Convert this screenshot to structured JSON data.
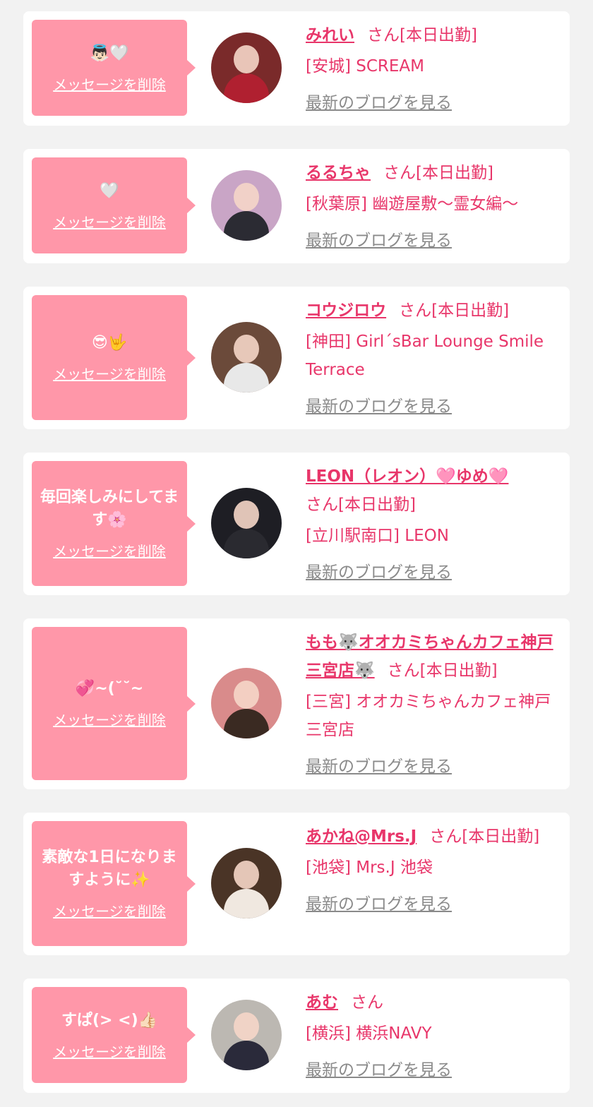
{
  "favorites": [
    {
      "message": "👼🏻🤍",
      "delete_label": "メッセージを削除",
      "name": "みれい",
      "suffix": "さん[本日出勤]",
      "shop": "[安城] SCREAM",
      "blog_label": "最新のブログを見る",
      "avatar_bg": "#7a2a2a",
      "avatar_body": "#b02030"
    },
    {
      "message": "🤍",
      "delete_label": "メッセージを削除",
      "name": "るるちゃ",
      "suffix": "さん[本日出勤]",
      "shop": "[秋葉原] 幽遊屋敷〜霊女編〜",
      "blog_label": "最新のブログを見る",
      "avatar_bg": "#c9a5c6",
      "avatar_body": "#2b2b33"
    },
    {
      "message": "😎🤟",
      "delete_label": "メッセージを削除",
      "name": "コウジロウ",
      "suffix": "さん[本日出勤]",
      "shop": "[神田] Girl´sBar Lounge Smile Terrace",
      "blog_label": "最新のブログを見る",
      "avatar_bg": "#6b4a3a",
      "avatar_body": "#e8e8e8"
    },
    {
      "message": "毎回楽しみにしてます🌸",
      "delete_label": "メッセージを削除",
      "name": "LEON（レオン）🩷ゆめ🩷",
      "suffix": "さん[本日出勤]",
      "shop": "[立川駅南口] LEON",
      "blog_label": "最新のブログを見る",
      "avatar_bg": "#1e1e24",
      "avatar_body": "#2a2a30"
    },
    {
      "message": "💞~(˘˘~",
      "delete_label": "メッセージを削除",
      "name": "もも🐺オオカミちゃんカフェ神戸三宮店🐺",
      "suffix": "さん[本日出勤]",
      "shop": "[三宮] オオカミちゃんカフェ神戸三宮店",
      "blog_label": "最新のブログを見る",
      "avatar_bg": "#d98b8b",
      "avatar_body": "#3a2a22"
    },
    {
      "message": "素敵な1日になりますように✨",
      "delete_label": "メッセージを削除",
      "name": "あかね@Mrs.J",
      "suffix": "さん[本日出勤]",
      "shop": "[池袋] Mrs.J 池袋",
      "blog_label": "最新のブログを見る",
      "avatar_bg": "#4a3426",
      "avatar_body": "#f0e8e0"
    },
    {
      "message": "すぱ(> <)👍🏻",
      "delete_label": "メッセージを削除",
      "name": "あむ",
      "suffix": "さん",
      "shop": "[横浜] 横浜NAVY",
      "blog_label": "最新のブログを見る",
      "avatar_bg": "#bcb8b2",
      "avatar_body": "#2a2a3a"
    }
  ]
}
